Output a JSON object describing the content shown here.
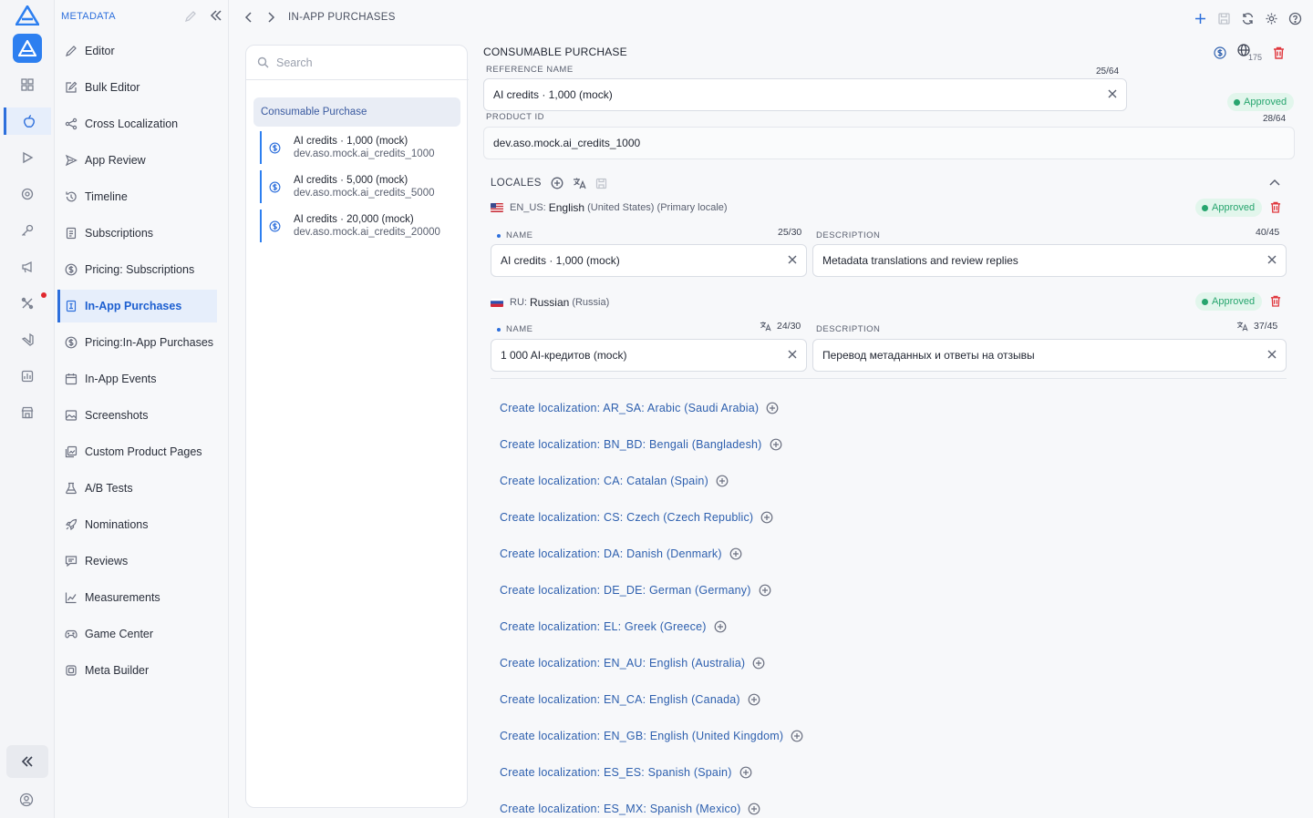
{
  "menu": {
    "header": "METADATA",
    "items": [
      {
        "label": "Editor",
        "icon": "pencil-icon"
      },
      {
        "label": "Bulk Editor",
        "icon": "edit-box-icon"
      },
      {
        "label": "Cross Localization",
        "icon": "share-icon"
      },
      {
        "label": "App Review",
        "icon": "send-icon"
      },
      {
        "label": "Timeline",
        "icon": "history-icon"
      },
      {
        "label": "Subscriptions",
        "icon": "document-icon"
      },
      {
        "label": "Pricing: Subscriptions",
        "icon": "dollar-icon"
      },
      {
        "label": "In-App Purchases",
        "icon": "receipt-icon",
        "active": true
      },
      {
        "label": "Pricing:In-App Purchases",
        "icon": "dollar-icon"
      },
      {
        "label": "In-App Events",
        "icon": "calendar-icon"
      },
      {
        "label": "Screenshots",
        "icon": "image-icon"
      },
      {
        "label": "Custom Product Pages",
        "icon": "pages-icon"
      },
      {
        "label": "A/B Tests",
        "icon": "flask-icon"
      },
      {
        "label": "Nominations",
        "icon": "rocket-icon"
      },
      {
        "label": "Reviews",
        "icon": "review-icon"
      },
      {
        "label": "Measurements",
        "icon": "chart-icon"
      },
      {
        "label": "Game Center",
        "icon": "gamepad-icon"
      },
      {
        "label": "Meta Builder",
        "icon": "cube-icon"
      }
    ]
  },
  "breadcrumb": {
    "title": "IN-APP PURCHASES"
  },
  "search": {
    "placeholder": "Search"
  },
  "list": {
    "group": "Consumable Purchase",
    "products": [
      {
        "name": "AI credits · 1,000 (mock)",
        "id": "dev.aso.mock.ai_credits_1000"
      },
      {
        "name": "AI credits · 5,000 (mock)",
        "id": "dev.aso.mock.ai_credits_5000"
      },
      {
        "name": "AI credits · 20,000 (mock)",
        "id": "dev.aso.mock.ai_credits_20000"
      }
    ]
  },
  "detail": {
    "title": "CONSUMABLE PURCHASE",
    "locale_count": "175",
    "reference_name": {
      "label": "REFERENCE NAME",
      "count": "25/64",
      "value": "AI credits · 1,000 (mock)"
    },
    "status": "Approved",
    "product_id": {
      "label": "PRODUCT ID",
      "count": "28/64",
      "value": "dev.aso.mock.ai_credits_1000"
    },
    "locales_label": "LOCALES",
    "locales": [
      {
        "code": "EN_US:",
        "name": "English",
        "region": "(United States) (Primary locale)",
        "status": "Approved",
        "name_label": "NAME",
        "name_count": "25/30",
        "name_value": "AI credits · 1,000 (mock)",
        "desc_label": "DESCRIPTION",
        "desc_count": "40/45",
        "desc_value": "Metadata translations and review replies"
      },
      {
        "code": "RU:",
        "name": "Russian",
        "region": "(Russia)",
        "status": "Approved",
        "name_label": "NAME",
        "name_count": "24/30",
        "name_value": "1 000 AI-кредитов (mock)",
        "desc_label": "DESCRIPTION",
        "desc_count": "37/45",
        "desc_value": "Перевод метаданных и ответы на отзывы"
      }
    ],
    "create_links": [
      "Create localization: AR_SA: Arabic (Saudi Arabia)",
      "Create localization: BN_BD: Bengali (Bangladesh)",
      "Create localization: CA: Catalan (Spain)",
      "Create localization: CS: Czech (Czech Republic)",
      "Create localization: DA: Danish (Denmark)",
      "Create localization: DE_DE: German (Germany)",
      "Create localization: EL: Greek (Greece)",
      "Create localization: EN_AU: English (Australia)",
      "Create localization: EN_CA: English (Canada)",
      "Create localization: EN_GB: English (United Kingdom)",
      "Create localization: ES_ES: Spanish (Spain)",
      "Create localization: ES_MX: Spanish (Mexico)"
    ]
  },
  "colors": {
    "accent": "#2d6fdc",
    "approved": "#27a56e",
    "danger": "#e0383e"
  }
}
